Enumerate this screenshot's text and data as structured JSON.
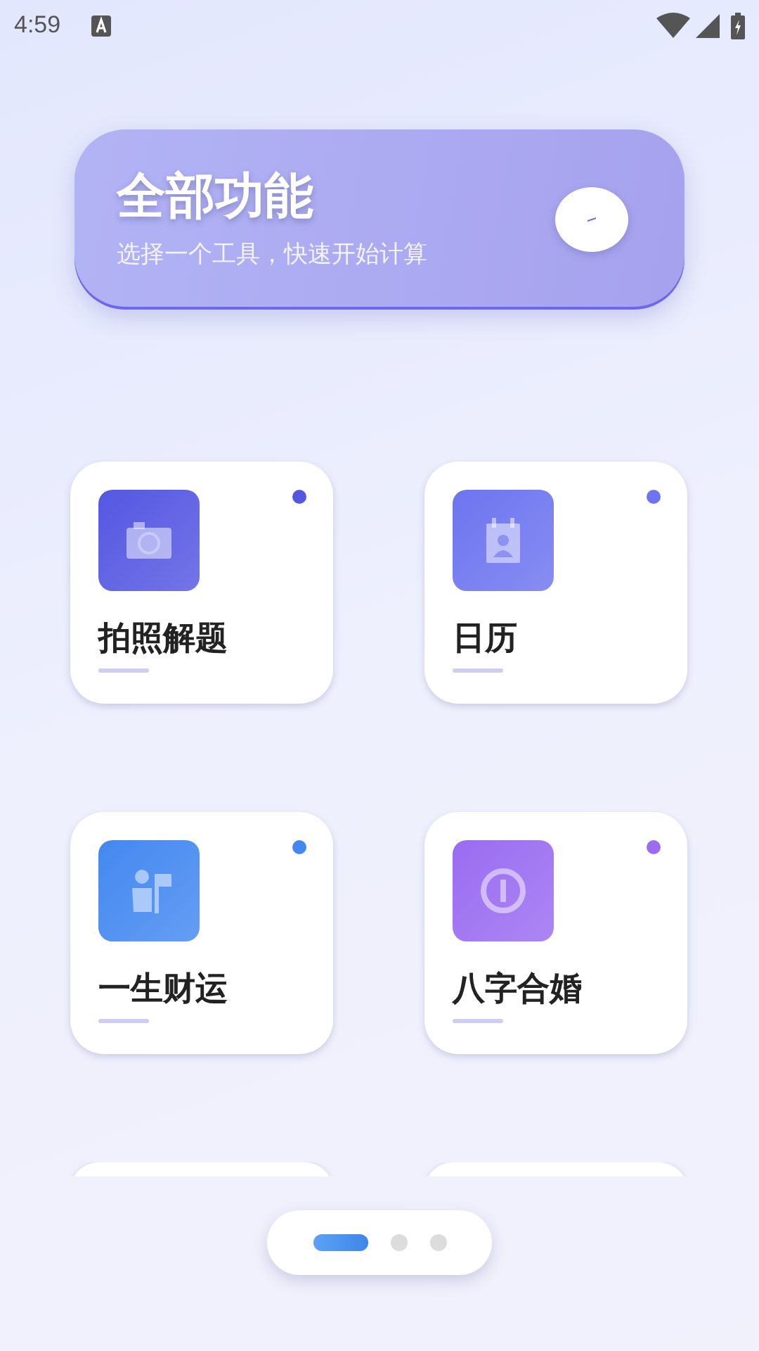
{
  "status_bar": {
    "time": "4:59"
  },
  "header": {
    "title": "全部功能",
    "subtitle": "选择一个工具，快速开始计算"
  },
  "tools": [
    {
      "label": "拍照解题",
      "kind": "camera",
      "color": "#5457e2"
    },
    {
      "label": "日历",
      "kind": "calendar",
      "color": "#6d74ef"
    },
    {
      "label": "一生财运",
      "kind": "person",
      "color": "#4388f0"
    },
    {
      "label": "八字合婚",
      "kind": "power",
      "color": "#9a6cf1"
    }
  ],
  "pager": [
    {
      "selected": true
    },
    {
      "selected": false
    },
    {
      "selected": false
    }
  ]
}
